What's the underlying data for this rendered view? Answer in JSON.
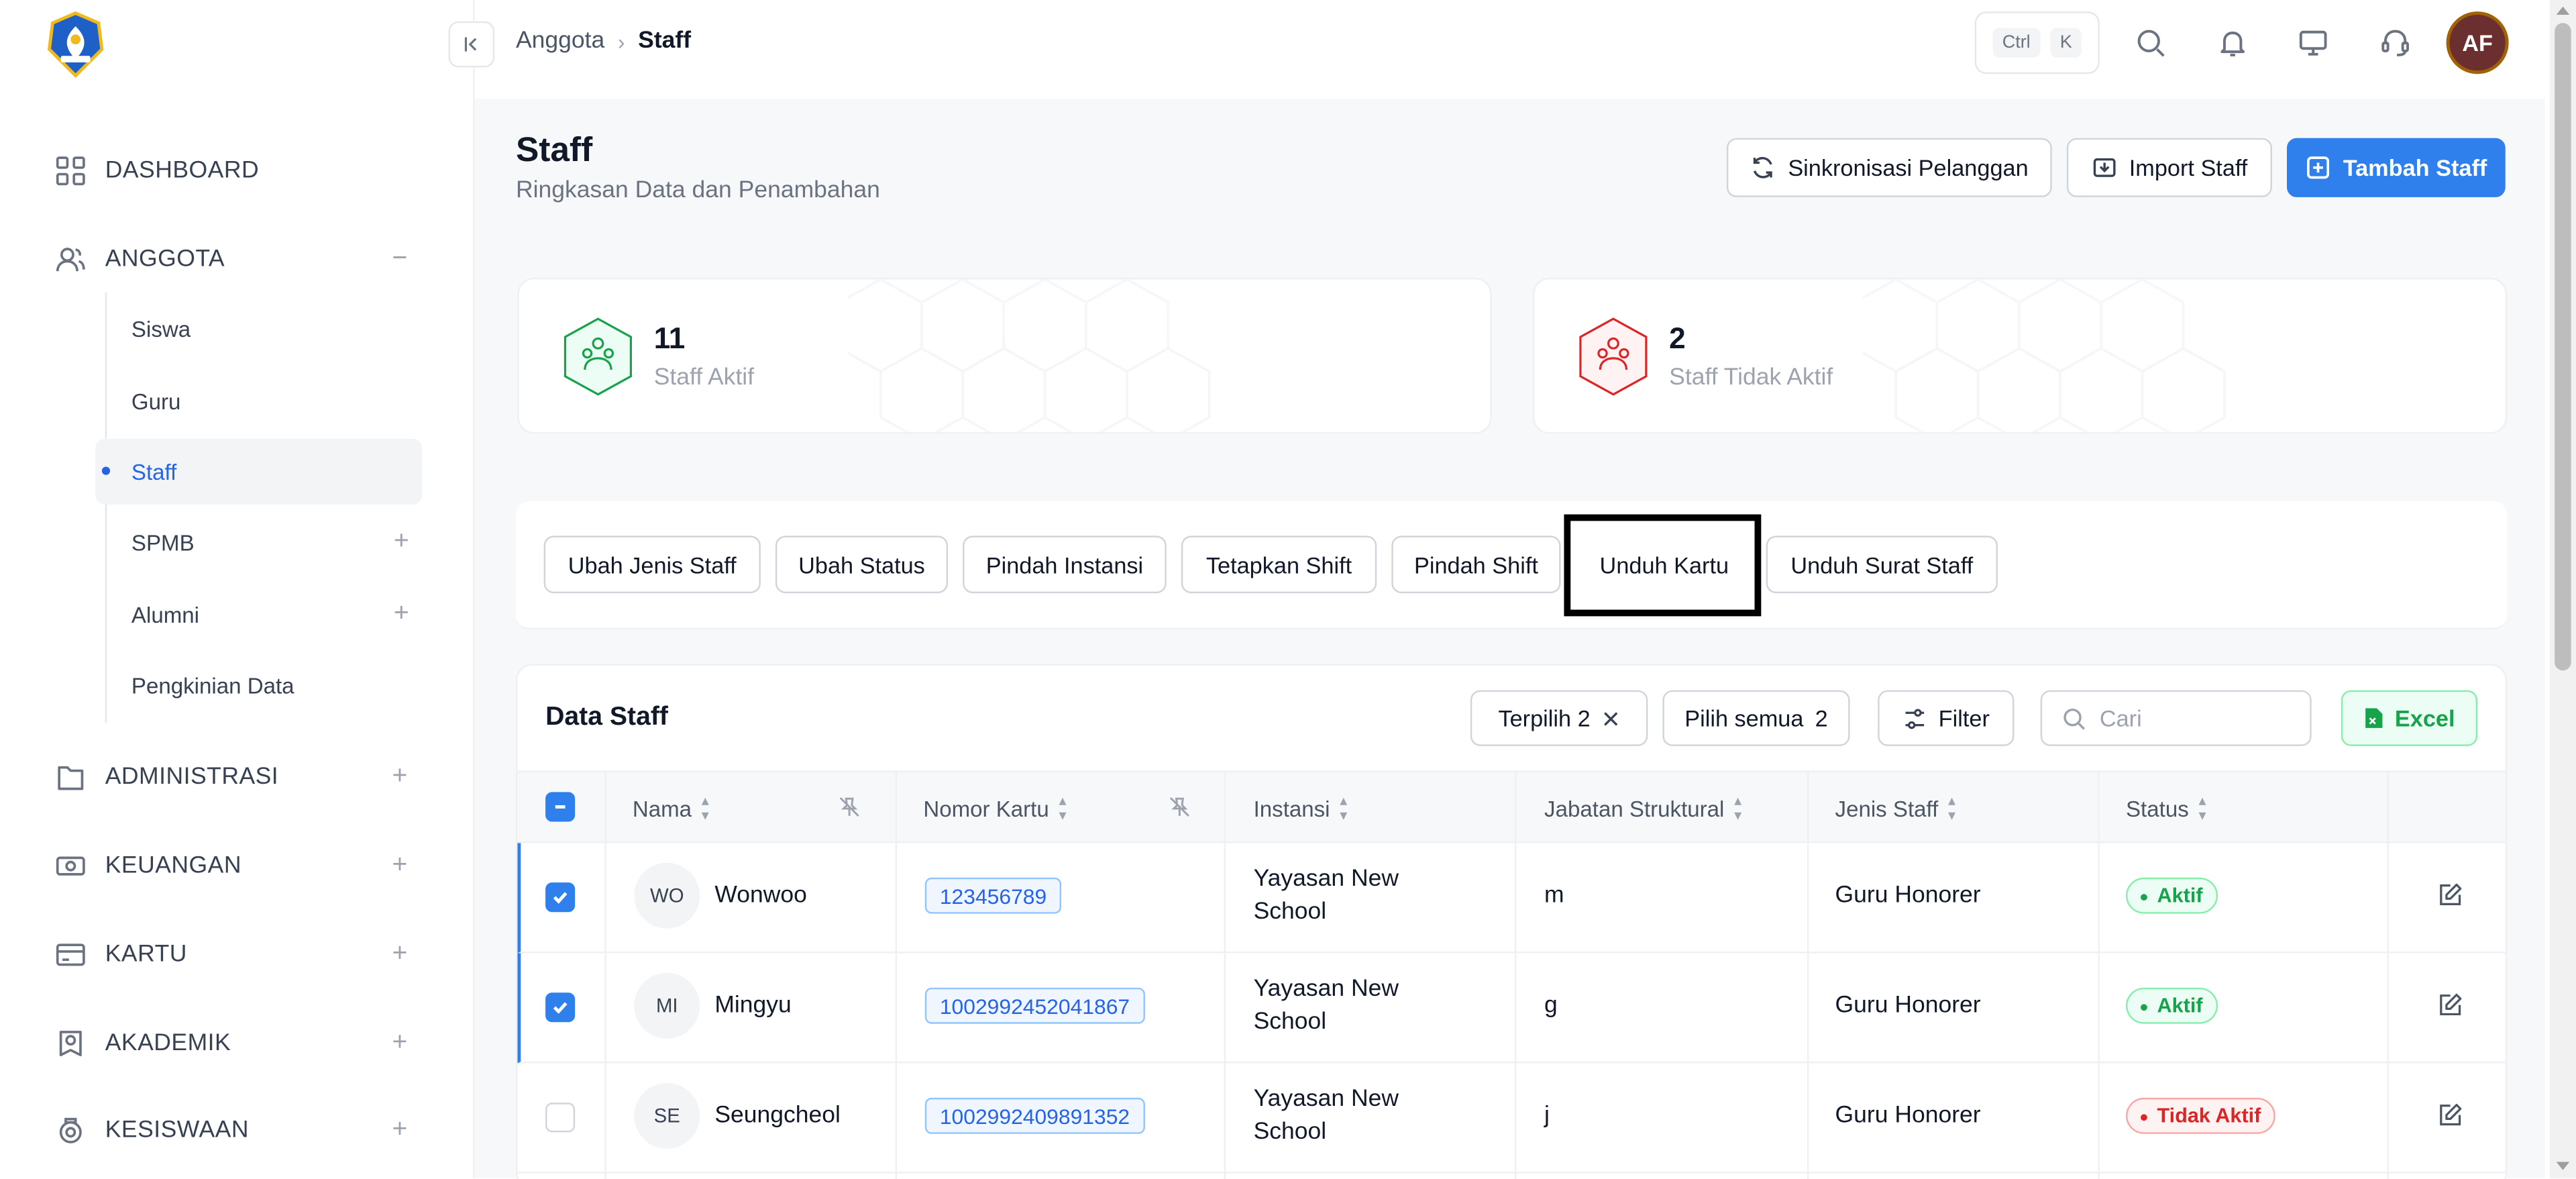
{
  "topbar": {
    "breadcrumb": [
      "Anggota",
      "Staff"
    ],
    "shortcut": [
      "Ctrl",
      "K"
    ],
    "avatar_initials": "AF"
  },
  "sidebar": {
    "items": [
      {
        "label": "DASHBOARD",
        "icon": "grid-icon"
      },
      {
        "label": "ANGGOTA",
        "icon": "users-icon",
        "toggle": "−"
      },
      {
        "label": "ADMINISTRASI",
        "icon": "folder-icon",
        "toggle": "+"
      },
      {
        "label": "KEUANGAN",
        "icon": "cash-icon",
        "toggle": "+"
      },
      {
        "label": "KARTU",
        "icon": "card-icon",
        "toggle": "+"
      },
      {
        "label": "AKADEMIK",
        "icon": "academic-icon",
        "toggle": "+"
      },
      {
        "label": "KESISWAAN",
        "icon": "student-icon",
        "toggle": "+"
      }
    ],
    "sub_items": [
      {
        "label": "Siswa"
      },
      {
        "label": "Guru"
      },
      {
        "label": "Staff",
        "active": true
      },
      {
        "label": "SPMB",
        "toggle": "+"
      },
      {
        "label": "Alumni",
        "toggle": "+"
      },
      {
        "label": "Pengkinian Data"
      }
    ]
  },
  "page": {
    "title": "Staff",
    "subtitle": "Ringkasan Data dan Penambahan",
    "buttons": {
      "sync": "Sinkronisasi Pelanggan",
      "import": "Import Staff",
      "add": "Tambah Staff"
    }
  },
  "stats": [
    {
      "value": "11",
      "label": "Staff Aktif",
      "color": "#16a34a"
    },
    {
      "value": "2",
      "label": "Staff Tidak Aktif",
      "color": "#dc2626"
    }
  ],
  "actions": [
    "Ubah Jenis Staff",
    "Ubah Status",
    "Pindah Instansi",
    "Tetapkan Shift",
    "Pindah Shift",
    "Unduh Kartu",
    "Unduh Surat Staff"
  ],
  "table": {
    "title": "Data Staff",
    "selected_label": "Terpilih 2",
    "select_all_label": "Pilih semua",
    "select_all_count": "2",
    "filter_label": "Filter",
    "search_placeholder": "Cari",
    "excel_label": "Excel",
    "columns": [
      "Nama",
      "Nomor Kartu",
      "Instansi",
      "Jabatan Struktural",
      "Jenis Staff",
      "Status"
    ],
    "rows": [
      {
        "checked": true,
        "initials": "WO",
        "name": "Wonwoo",
        "card": "123456789",
        "instansi_1": "Yayasan New",
        "instansi_2": "School",
        "jabatan": "m",
        "jenis": "Guru Honorer",
        "status": "Aktif",
        "active": true
      },
      {
        "checked": true,
        "initials": "MI",
        "name": "Mingyu",
        "card": "1002992452041867",
        "instansi_1": "Yayasan New",
        "instansi_2": "School",
        "jabatan": "g",
        "jenis": "Guru Honorer",
        "status": "Aktif",
        "active": true
      },
      {
        "checked": false,
        "initials": "SE",
        "name": "Seungcheol",
        "card": "1002992409891352",
        "instansi_1": "Yayasan New",
        "instansi_2": "School",
        "jabatan": "j",
        "jenis": "Guru Honorer",
        "status": "Tidak Aktif",
        "active": false
      }
    ]
  },
  "colors": {
    "primary": "#2f80ed",
    "success": "#16a34a",
    "danger": "#dc2626"
  }
}
